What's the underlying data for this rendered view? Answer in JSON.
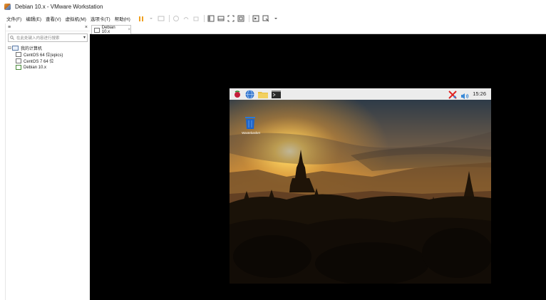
{
  "window": {
    "title": "Debian 10.x - VMware Workstation"
  },
  "menu": {
    "items": [
      "文件(F)",
      "编辑(E)",
      "查看(V)",
      "虚拟机(M)",
      "选项卡(T)",
      "帮助(H)"
    ]
  },
  "sidebar": {
    "header": "≡",
    "close": "×",
    "search_placeholder": "在此处键入内容进行搜索",
    "tree": {
      "root": "我的计算机",
      "items": [
        "CentOS 64 位(epics)",
        "CentOS 7 64 位",
        "Debian 10.x"
      ]
    }
  },
  "tabs": [
    {
      "label": "Debian 10.x",
      "close": "×"
    }
  ],
  "guest": {
    "clock": "15:26",
    "desktop_icon_label": "Wastebasket",
    "colors": {
      "panel": "#ececec",
      "sky_top": "#2b3a4a",
      "sun": "#ffd460",
      "silhouette": "#1a1208"
    }
  }
}
